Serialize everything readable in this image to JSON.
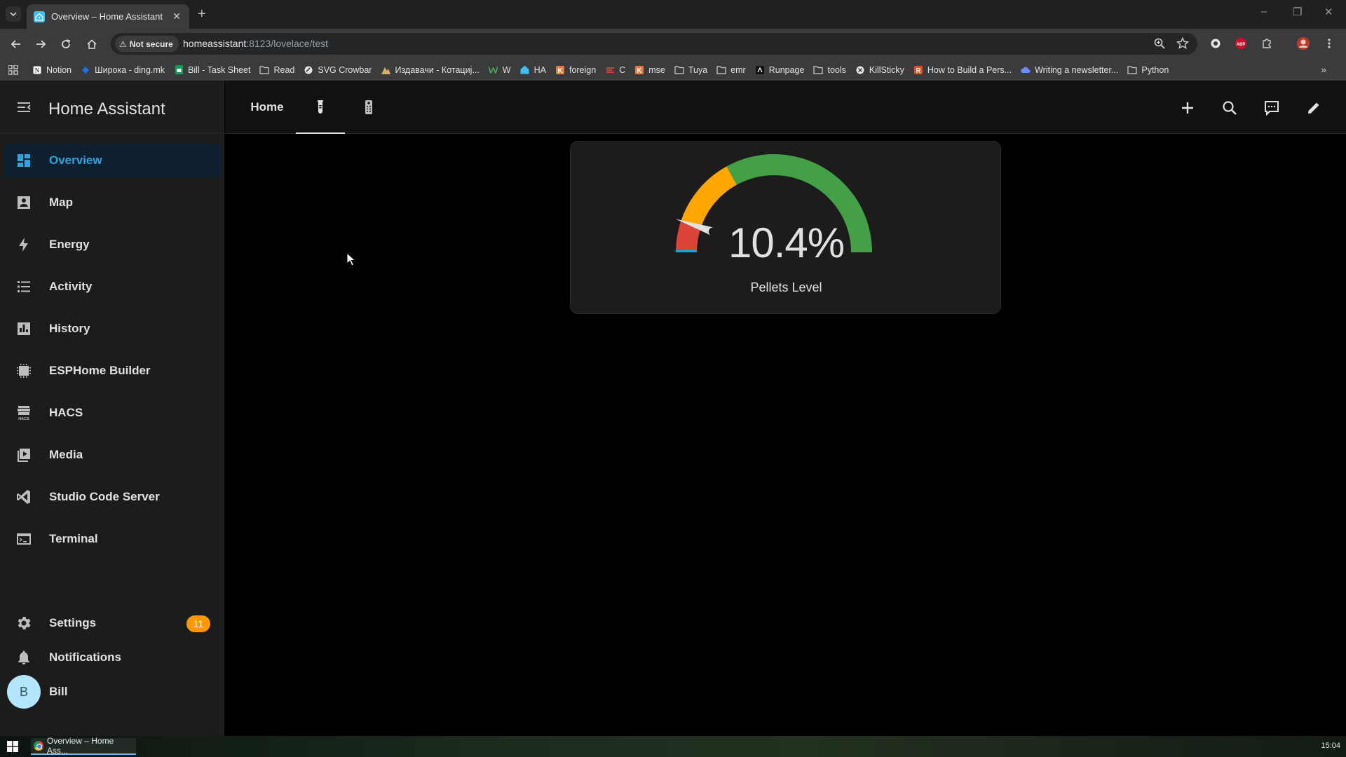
{
  "browser": {
    "tab_title": "Overview – Home Assistant",
    "close_glyph": "✕",
    "new_tab_glyph": "+",
    "security_label": "Not secure",
    "url_host": "homeassistant",
    "url_rest": ":8123/lovelace/test",
    "window_controls": [
      "–",
      "❐",
      "✕"
    ],
    "bookmarks": [
      {
        "label": "Notion",
        "icon": "notion-icon"
      },
      {
        "label": "Широка - ding.mk",
        "icon": "ding-icon"
      },
      {
        "label": "Bill - Task Sheet",
        "icon": "sheets-icon"
      },
      {
        "label": "Read",
        "icon": "folder-icon"
      },
      {
        "label": "SVG Crowbar",
        "icon": "crowbar-icon"
      },
      {
        "label": "Издавачи - Котациј...",
        "icon": "publisher-icon"
      },
      {
        "label": "W",
        "icon": "w-icon"
      },
      {
        "label": "HA",
        "icon": "ha-icon"
      },
      {
        "label": "foreign",
        "icon": "k-icon"
      },
      {
        "label": "C",
        "icon": "c-icon"
      },
      {
        "label": "mse",
        "icon": "k-icon"
      },
      {
        "label": "Tuya",
        "icon": "folder-icon"
      },
      {
        "label": "emr",
        "icon": "folder-icon"
      },
      {
        "label": "Runpage",
        "icon": "runpage-icon"
      },
      {
        "label": "tools",
        "icon": "folder-icon"
      },
      {
        "label": "KillSticky",
        "icon": "killsticky-icon"
      },
      {
        "label": "How to Build a Pers...",
        "icon": "r-icon"
      },
      {
        "label": "Writing a newsletter...",
        "icon": "cloud-icon"
      },
      {
        "label": "Python",
        "icon": "folder-icon"
      }
    ]
  },
  "ha": {
    "title": "Home Assistant",
    "views": {
      "home_label": "Home"
    },
    "sidebar": {
      "items": [
        {
          "label": "Overview",
          "icon": "view-dashboard-icon"
        },
        {
          "label": "Map",
          "icon": "map-icon"
        },
        {
          "label": "Energy",
          "icon": "lightning-icon"
        },
        {
          "label": "Activity",
          "icon": "list-icon"
        },
        {
          "label": "History",
          "icon": "chart-box-icon"
        },
        {
          "label": "ESPHome Builder",
          "icon": "chip-icon"
        },
        {
          "label": "HACS",
          "icon": "hacs-icon"
        },
        {
          "label": "Media",
          "icon": "play-box-icon"
        },
        {
          "label": "Studio Code Server",
          "icon": "vscode-icon"
        },
        {
          "label": "Terminal",
          "icon": "console-icon"
        }
      ],
      "settings": {
        "label": "Settings",
        "badge": "11"
      },
      "notifications": {
        "label": "Notifications"
      },
      "user": {
        "label": "Bill",
        "initial": "B"
      }
    },
    "card": {
      "value": "10.4%",
      "name": "Pellets Level",
      "level": 0.104,
      "colors": {
        "low": "#db4437",
        "mid": "#ffa600",
        "high": "#43a047",
        "accent": "#03a9f4"
      }
    }
  },
  "taskbar": {
    "app_label": "Overview – Home Ass...",
    "clock": "15:04"
  }
}
